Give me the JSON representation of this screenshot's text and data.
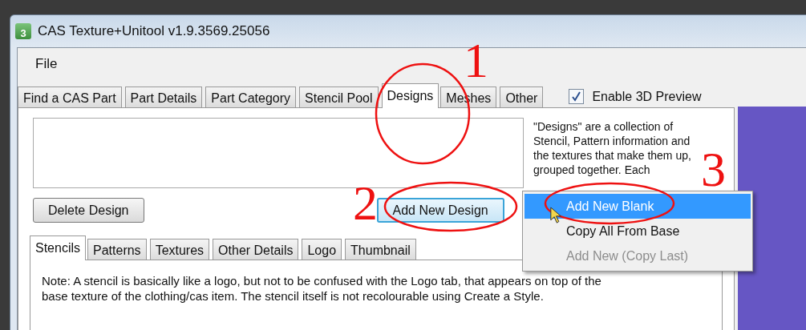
{
  "window": {
    "title": "CAS Texture+Unitool v1.9.3569.25056",
    "icon_label": "3"
  },
  "menu_bar": [
    "File"
  ],
  "tabs": [
    {
      "label": "Find a CAS Part",
      "selected": false
    },
    {
      "label": "Part Details",
      "selected": false
    },
    {
      "label": "Part Category",
      "selected": false
    },
    {
      "label": "Stencil Pool",
      "selected": false
    },
    {
      "label": "Designs",
      "selected": true
    },
    {
      "label": "Meshes",
      "selected": false
    },
    {
      "label": "Other",
      "selected": false
    }
  ],
  "preview_checkbox": {
    "label": "Enable 3D Preview",
    "checked": true
  },
  "designs": {
    "description": "\"Designs\" are a collection of Stencil, Pattern information and the textures that make them up, grouped together.  Each",
    "buttons": [
      {
        "label": "Delete Design",
        "focused": false
      },
      {
        "label": "Add New Design",
        "focused": true
      }
    ]
  },
  "sub_tabs": [
    {
      "label": "Stencils",
      "selected": true
    },
    {
      "label": "Patterns",
      "selected": false
    },
    {
      "label": "Textures",
      "selected": false
    },
    {
      "label": "Other Details",
      "selected": false
    },
    {
      "label": "Logo",
      "selected": false
    },
    {
      "label": "Thumbnail",
      "selected": false
    }
  ],
  "note": "Note: A stencil is basically like a logo, but not to be confused with the Logo tab, that appears on top of the base texture of the clothing/cas item.  The stencil itself is not recolourable using Create a Style.",
  "context_menu": [
    {
      "label": "Add New Blank",
      "selected": true,
      "disabled": false
    },
    {
      "label": "Copy All From Base",
      "selected": false,
      "disabled": false
    },
    {
      "label": "Add New (Copy Last)",
      "selected": false,
      "disabled": true
    }
  ],
  "annotations": [
    "1",
    "2",
    "3"
  ]
}
